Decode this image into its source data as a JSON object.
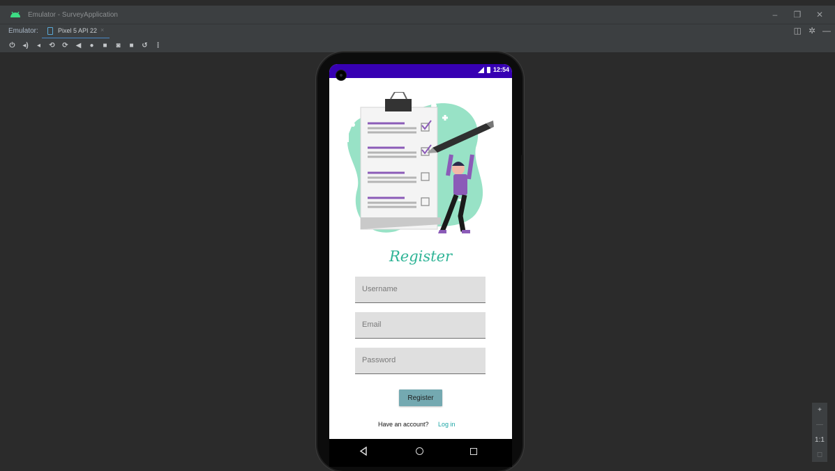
{
  "window": {
    "title": "Emulator - SurveyApplication",
    "controls": {
      "minimize": "–",
      "restore": "❐",
      "close": "✕"
    }
  },
  "tabbar": {
    "label": "Emulator:",
    "device_tab": "Pixel 5 API 22",
    "close_glyph": "×",
    "right_icons": [
      "◫",
      "✲",
      "—"
    ]
  },
  "toolbar": {
    "icons": [
      {
        "name": "power-icon",
        "glyph": "⏻"
      },
      {
        "name": "volume-up-icon",
        "glyph": "◂)"
      },
      {
        "name": "volume-down-icon",
        "glyph": "◂"
      },
      {
        "name": "rotate-left-icon",
        "glyph": "⟲"
      },
      {
        "name": "rotate-right-icon",
        "glyph": "⟳"
      },
      {
        "name": "back-icon",
        "glyph": "◀"
      },
      {
        "name": "home-icon",
        "glyph": "●"
      },
      {
        "name": "overview-icon",
        "glyph": "■"
      },
      {
        "name": "screenshot-icon",
        "glyph": "◙"
      },
      {
        "name": "record-icon",
        "glyph": "■"
      },
      {
        "name": "snapshot-icon",
        "glyph": "↺"
      },
      {
        "name": "more-icon",
        "glyph": "⋮"
      }
    ]
  },
  "device": {
    "status_time": "12:54",
    "status_color": "#3700b3",
    "screen_title": "Register",
    "fields": {
      "username_placeholder": "Username",
      "email_placeholder": "Email",
      "password_placeholder": "Password"
    },
    "register_button": "Register",
    "have_account_text": "Have an account?",
    "login_link": "Log in",
    "accent_color": "#2fb496",
    "button_color": "#74a9b1"
  },
  "zoom": {
    "in": "+",
    "out": "—",
    "actual": "1:1",
    "fit": "◻"
  }
}
